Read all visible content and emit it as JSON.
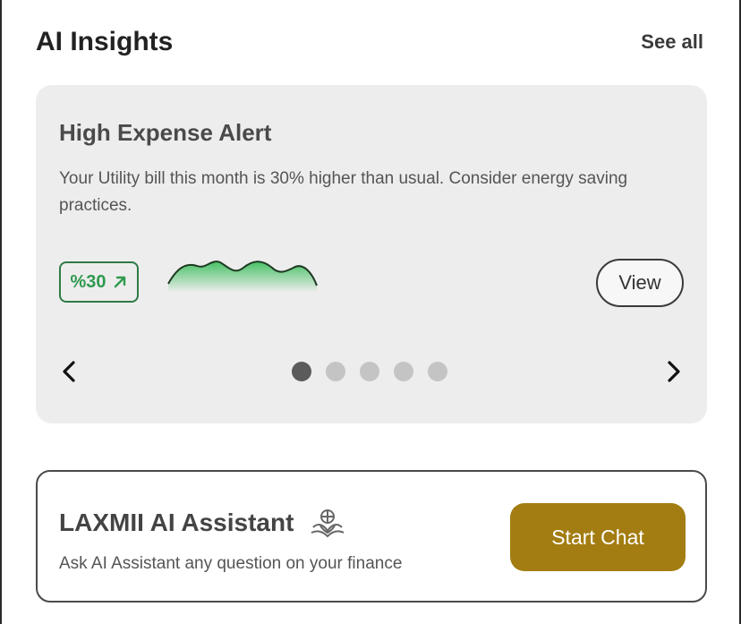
{
  "header": {
    "title": "AI Insights",
    "see_all": "See all"
  },
  "insight": {
    "title": "High Expense Alert",
    "body": "Your Utility bill this month is 30% higher than usual. Consider energy saving practices.",
    "badge": "%30",
    "badge_icon": "arrow-up-right-icon",
    "view_label": "View",
    "total_slides": 5,
    "active_slide": 1,
    "colors": {
      "badge": "#2f9a4f",
      "sparkline": "#3fbf5f"
    }
  },
  "assistant": {
    "title": "LAXMII AI Assistant",
    "subtitle": "Ask AI Assistant any question on your finance",
    "button": "Start Chat",
    "colors": {
      "button": "#a37d11"
    }
  }
}
